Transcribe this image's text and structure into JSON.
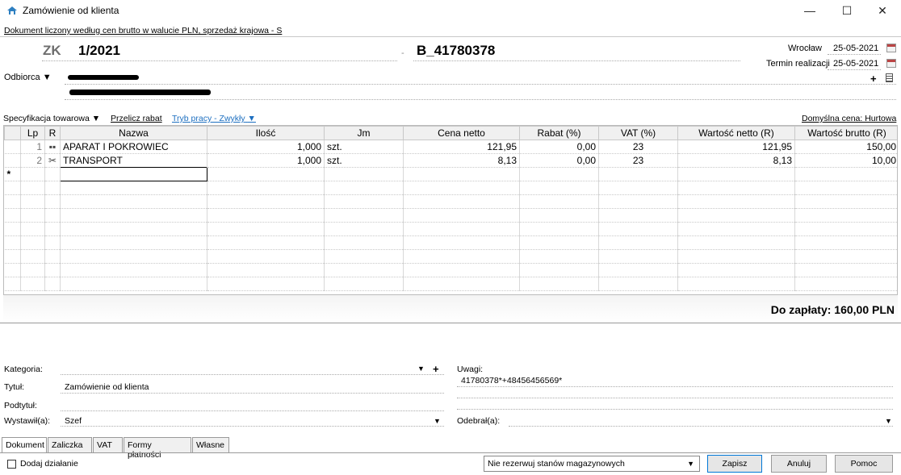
{
  "window": {
    "title": "Zamówienie od klienta",
    "minimize": "—",
    "maximize": "☐",
    "close": "✕"
  },
  "doc_info": "Dokument liczony według cen brutto w walucie PLN, sprzedaż krajowa - S",
  "header": {
    "prefix": "ZK",
    "number": "1/2021",
    "separator": "-",
    "external_number": "B_41780378",
    "city_label": "Wrocław",
    "city_date": "25-05-2021",
    "termin_label": "Termin realizacji",
    "termin_date": "25-05-2021"
  },
  "odbiorca": {
    "label": "Odbiorca",
    "add": "+"
  },
  "toolbar": {
    "spec": "Specyfikacja towarowa",
    "przelicz": "Przelicz rabat",
    "tryb": "Tryb pracy - Zwykły",
    "domyslna": "Domyślna cena: Hurtowa"
  },
  "table": {
    "columns": [
      "Lp",
      "R",
      "Nazwa",
      "Ilość",
      "Jm",
      "Cena netto",
      "Rabat (%)",
      "VAT (%)",
      "Wartość netto (R)",
      "Wartość brutto (R)"
    ],
    "rows": [
      {
        "lp": "1",
        "r_icon": "product-icon",
        "r": "▪▪",
        "nazwa": "APARAT I POKROWIEC",
        "ilosc": "1,000",
        "jm": "szt.",
        "cena": "121,95",
        "rabat": "0,00",
        "vat": "23",
        "netto": "121,95",
        "brutto": "150,00"
      },
      {
        "lp": "2",
        "r_icon": "service-icon",
        "r": "✂",
        "nazwa": "TRANSPORT",
        "ilosc": "1,000",
        "jm": "szt.",
        "cena": "8,13",
        "rabat": "0,00",
        "vat": "23",
        "netto": "8,13",
        "brutto": "10,00"
      }
    ],
    "new_row_marker": "*"
  },
  "total": "Do zapłaty: 160,00 PLN",
  "form": {
    "kategoria_label": "Kategoria:",
    "tytul_label": "Tytuł:",
    "tytul_value": "Zamówienie od klienta",
    "podtytul_label": "Podtytuł:",
    "wystawil_label": "Wystawił(a):",
    "wystawil_value": "Szef",
    "uwagi_label": "Uwagi:",
    "uwagi_value": "41780378*+48456456569*",
    "odebral_label": "Odebrał(a):"
  },
  "tabs": [
    "Dokument",
    "Zaliczka",
    "VAT",
    "Formy płatności",
    "Własne"
  ],
  "footer": {
    "checkbox_label": "Dodaj działanie",
    "reserve_select": "Nie rezerwuj stanów magazynowych",
    "save": "Zapisz",
    "cancel": "Anuluj",
    "help": "Pomoc"
  }
}
